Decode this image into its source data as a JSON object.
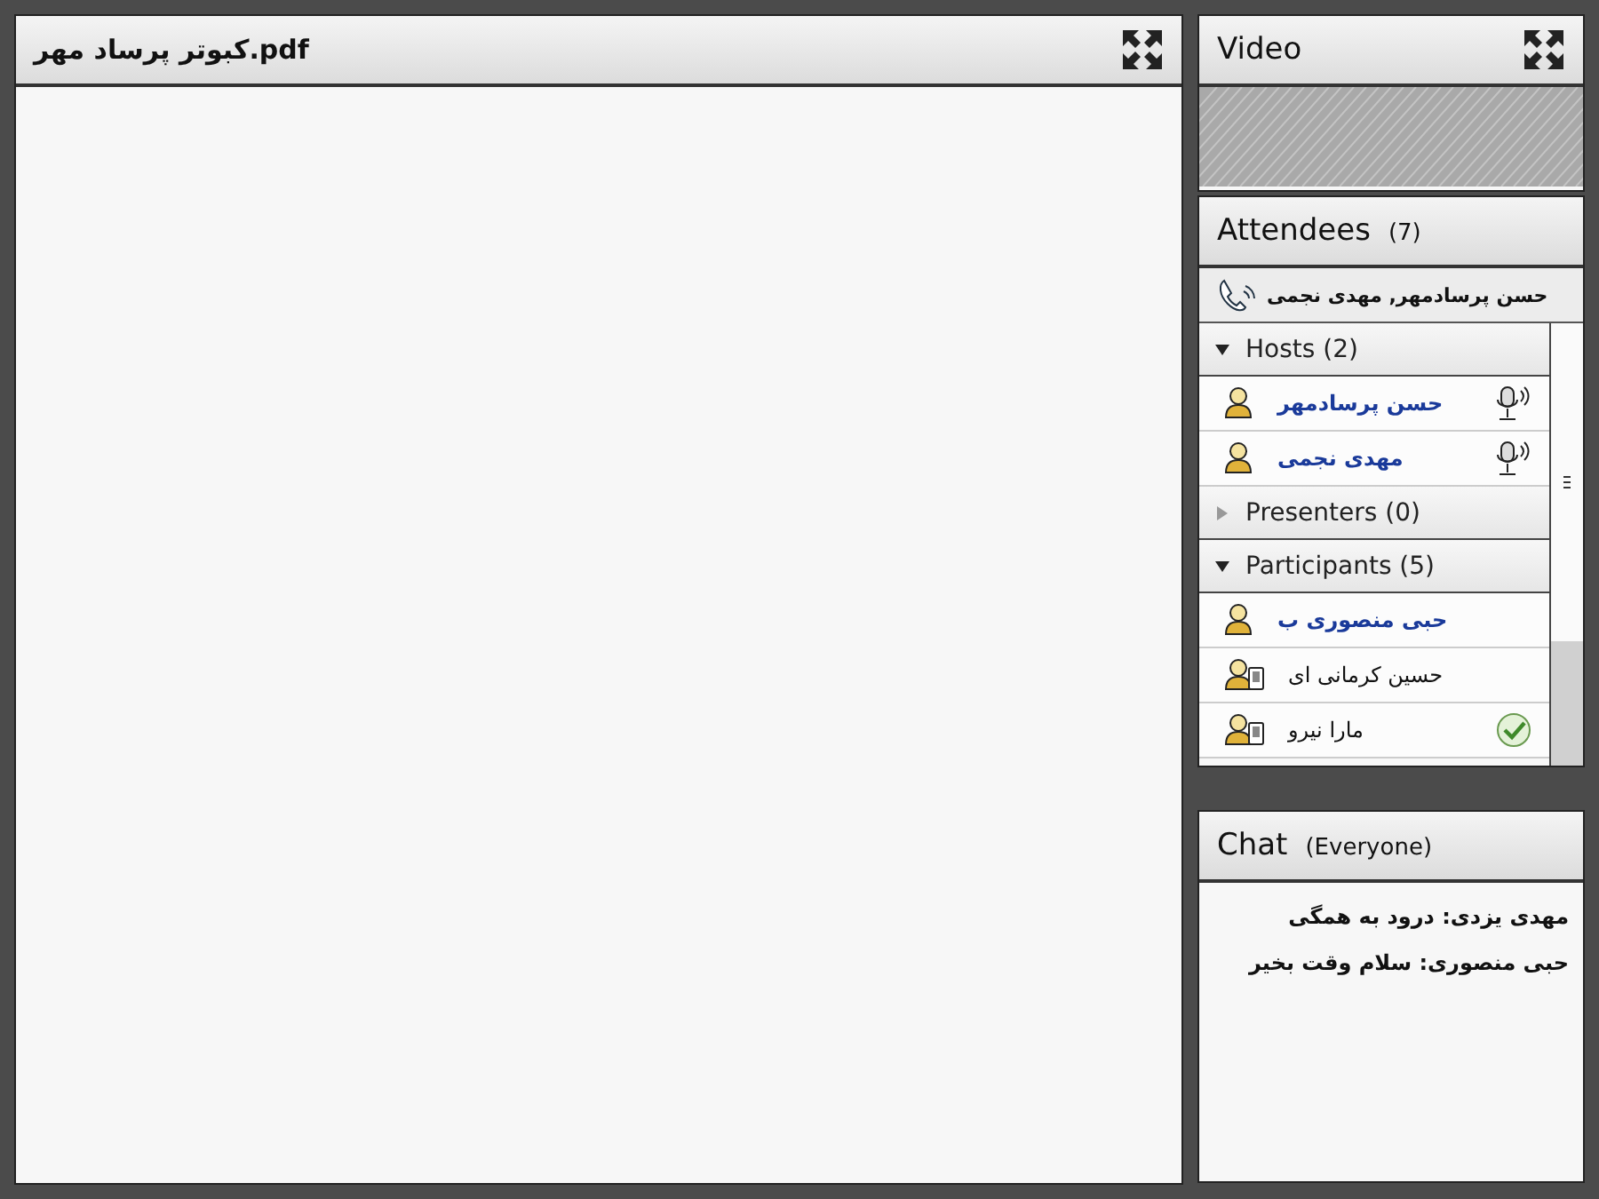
{
  "document": {
    "title": "کبوتر پرساد مهر.pdf"
  },
  "video": {
    "title": "Video"
  },
  "attendees": {
    "title": "Attendees",
    "count": "(7)",
    "call": "حسن پرسادمهر, مهدی نجمی",
    "groups": [
      {
        "label": "Hosts (2)",
        "expanded": true,
        "people": [
          {
            "name": "حسن پرسادمهر",
            "emphasized": true,
            "kind": "desktop",
            "mic": true,
            "checked": false
          },
          {
            "name": "مهدی نجمی",
            "emphasized": true,
            "kind": "desktop",
            "mic": true,
            "checked": false
          }
        ]
      },
      {
        "label": "Presenters (0)",
        "expanded": false
      },
      {
        "label": "Participants (5)",
        "expanded": true,
        "people": [
          {
            "name": "حبی منصوری ب",
            "emphasized": true,
            "kind": "desktop",
            "mic": false,
            "checked": false
          },
          {
            "name": "حسین کرمانی ای",
            "emphasized": false,
            "kind": "mobile",
            "mic": false,
            "checked": false
          },
          {
            "name": "مارا نیرو",
            "emphasized": false,
            "kind": "mobile",
            "mic": false,
            "checked": true
          }
        ]
      }
    ]
  },
  "chat": {
    "title": "Chat",
    "audience": "(Everyone)",
    "messages": [
      "مهدی یزدی: درود به همگی",
      "حبی منصوری: سلام وقت بخیر"
    ]
  }
}
